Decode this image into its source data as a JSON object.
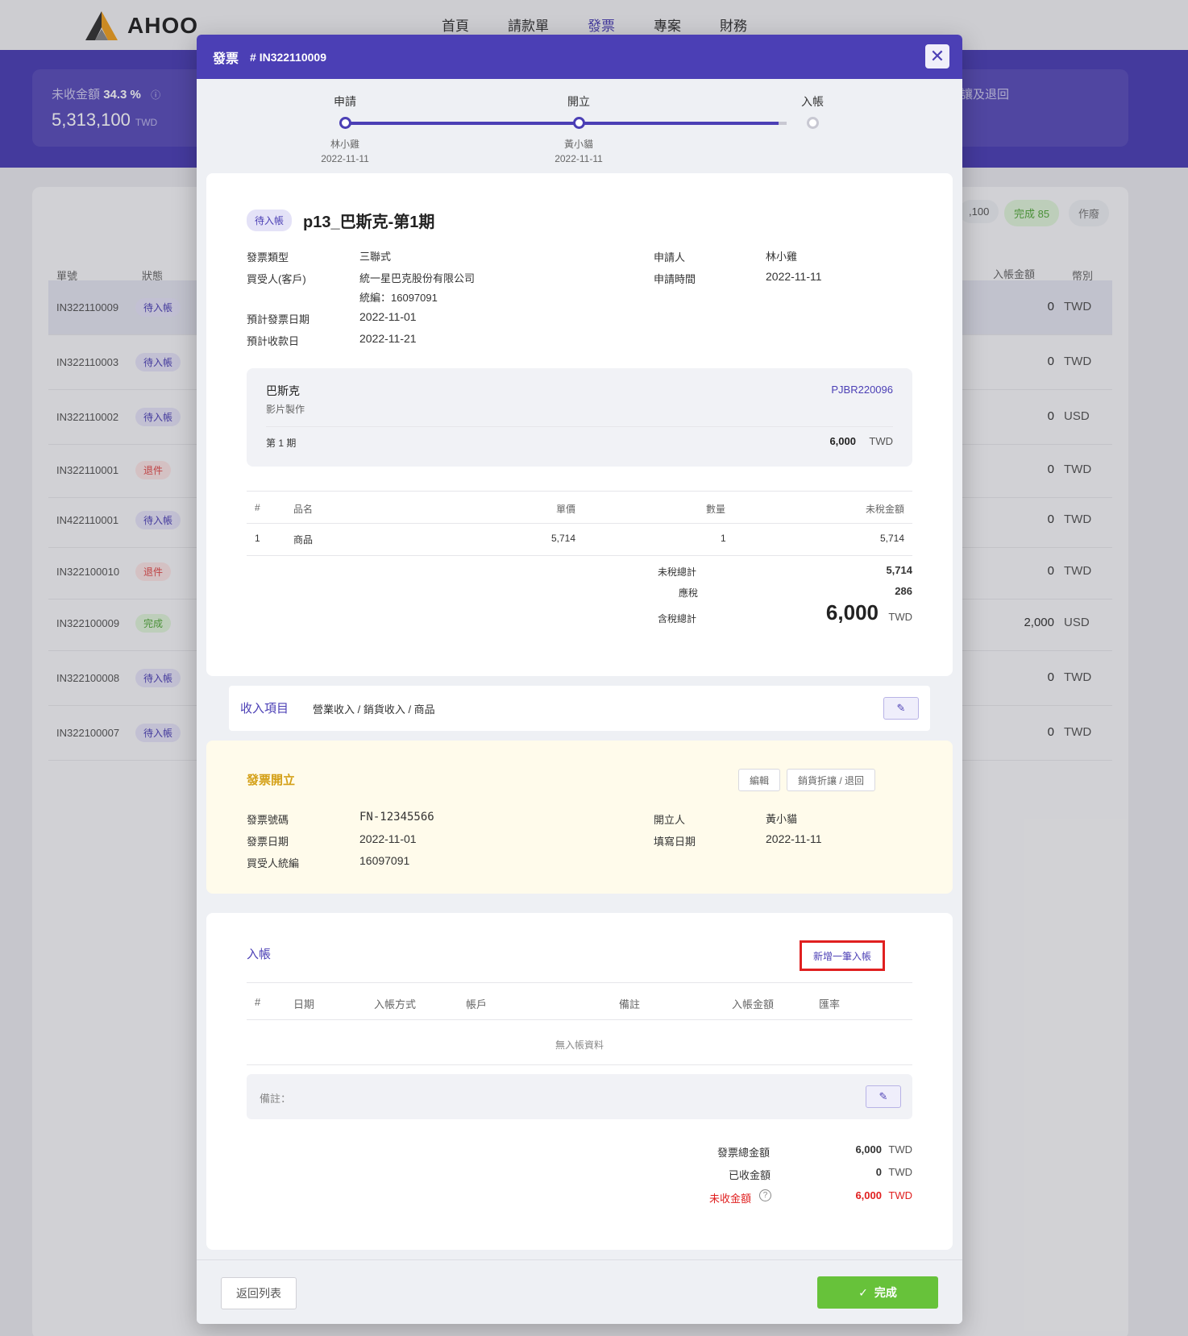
{
  "app": {
    "logo_text": "AHOO",
    "nav": [
      "首頁",
      "請款單",
      "發票",
      "專案",
      "財務"
    ],
    "nav_active": 2,
    "summary": {
      "label": "未收金額",
      "percent": "34.3 %",
      "value": "5,313,100",
      "unit": "TWD",
      "right_label_fragment": "讓及退回"
    },
    "chips": [
      {
        "label": ",100"
      },
      {
        "label": "完成",
        "count": "85"
      },
      {
        "label": "作廢"
      }
    ],
    "list_headers": {
      "no": "單號",
      "status": "狀態",
      "amount": "入帳金額",
      "currency": "幣別"
    },
    "rows": [
      {
        "no": "IN322110009",
        "status": "待入帳",
        "status_type": "pending",
        "amount": "0",
        "currency": "TWD",
        "selected": true
      },
      {
        "no": "IN322110003",
        "status": "待入帳",
        "status_type": "pending",
        "amount": "0",
        "currency": "TWD"
      },
      {
        "no": "IN322110002",
        "status": "待入帳",
        "status_type": "pending",
        "amount": "0",
        "currency": "USD"
      },
      {
        "no": "IN322110001",
        "status": "退件",
        "status_type": "returned",
        "amount": "0",
        "currency": "TWD"
      },
      {
        "no": "IN422110001",
        "status": "待入帳",
        "status_type": "pending",
        "amount": "0",
        "currency": "TWD"
      },
      {
        "no": "IN322100010",
        "status": "退件",
        "status_type": "returned",
        "amount": "0",
        "currency": "TWD"
      },
      {
        "no": "IN322100009",
        "status": "完成",
        "status_type": "done",
        "amount": "2,000",
        "currency": "USD"
      },
      {
        "no": "IN322100008",
        "status": "待入帳",
        "status_type": "pending",
        "amount": "0",
        "currency": "TWD"
      },
      {
        "no": "IN322100007",
        "status": "待入帳",
        "status_type": "pending",
        "amount": "0",
        "currency": "TWD"
      }
    ]
  },
  "modal": {
    "title": "發票",
    "invoice_id": "# IN322110009",
    "steps": [
      {
        "label": "申請",
        "who": "林小雞",
        "when": "2022-11-11",
        "done": true
      },
      {
        "label": "開立",
        "who": "黃小貓",
        "when": "2022-11-11",
        "done": true
      },
      {
        "label": "入帳",
        "who": "",
        "when": "",
        "done": false
      }
    ],
    "detail": {
      "status_badge": "待入帳",
      "title": "p13_巴斯克-第1期",
      "left_fields": [
        {
          "label": "發票類型",
          "value": "三聯式"
        },
        {
          "label": "買受人(客戶)",
          "value": "統一星巴克股份有限公司"
        },
        {
          "label": "",
          "value": "統編：16097091"
        },
        {
          "label": "預計發票日期",
          "value": "2022-11-01"
        },
        {
          "label": "預計收款日",
          "value": "2022-11-21"
        }
      ],
      "right_fields": [
        {
          "label": "申請人",
          "value": "林小雞"
        },
        {
          "label": "申請時間",
          "value": "2022-11-11"
        }
      ],
      "project": {
        "name": "巴斯克",
        "category": "影片製作",
        "code": "PJBR220096",
        "period": "第 1 期",
        "amount": "6,000",
        "currency": "TWD"
      },
      "items_headers": [
        "#",
        "品名",
        "單價",
        "數量",
        "未稅金額"
      ],
      "items": [
        {
          "idx": "1",
          "name": "商品",
          "price": "5,714",
          "qty": "1",
          "subtotal": "5,714"
        }
      ],
      "totals": {
        "pretax_label": "未稅總計",
        "pretax": "5,714",
        "tax_label": "應稅",
        "tax": "286",
        "total_label": "含稅總計",
        "total": "6,000",
        "currency": "TWD"
      }
    },
    "income": {
      "label": "收入項目",
      "value": "營業收入 / 銷貨收入 / 商品"
    },
    "issued": {
      "title": "發票開立",
      "edit_label": "編輯",
      "discount_label": "銷貨折讓 / 退回",
      "left_fields": [
        {
          "label": "發票號碼",
          "value": "FN-12345566"
        },
        {
          "label": "發票日期",
          "value": "2022-11-01"
        },
        {
          "label": "買受人統編",
          "value": "16097091"
        }
      ],
      "right_fields": [
        {
          "label": "開立人",
          "value": "黃小貓"
        },
        {
          "label": "填寫日期",
          "value": "2022-11-11"
        }
      ]
    },
    "receipt": {
      "title": "入帳",
      "add_label": "新增一筆入帳",
      "headers": [
        "#",
        "日期",
        "入帳方式",
        "帳戶",
        "備註",
        "入帳金額",
        "匯率"
      ],
      "empty": "無入帳資料",
      "note_label": "備註：",
      "summary": [
        {
          "label": "發票總金額",
          "value": "6,000",
          "currency": "TWD",
          "alert": false
        },
        {
          "label": "已收金額",
          "value": "0",
          "currency": "TWD",
          "alert": false
        },
        {
          "label": "未收金額",
          "value": "6,000",
          "currency": "TWD",
          "alert": true
        }
      ]
    },
    "footer": {
      "back_label": "返回列表",
      "done_label": "完成"
    }
  },
  "colors": {
    "primary": "#4b3fb5",
    "success": "#67c23a",
    "danger": "#e02020",
    "issued_bg": "#fffbeb",
    "issued_title": "#d4a017",
    "highlight_box": "#e02020"
  }
}
